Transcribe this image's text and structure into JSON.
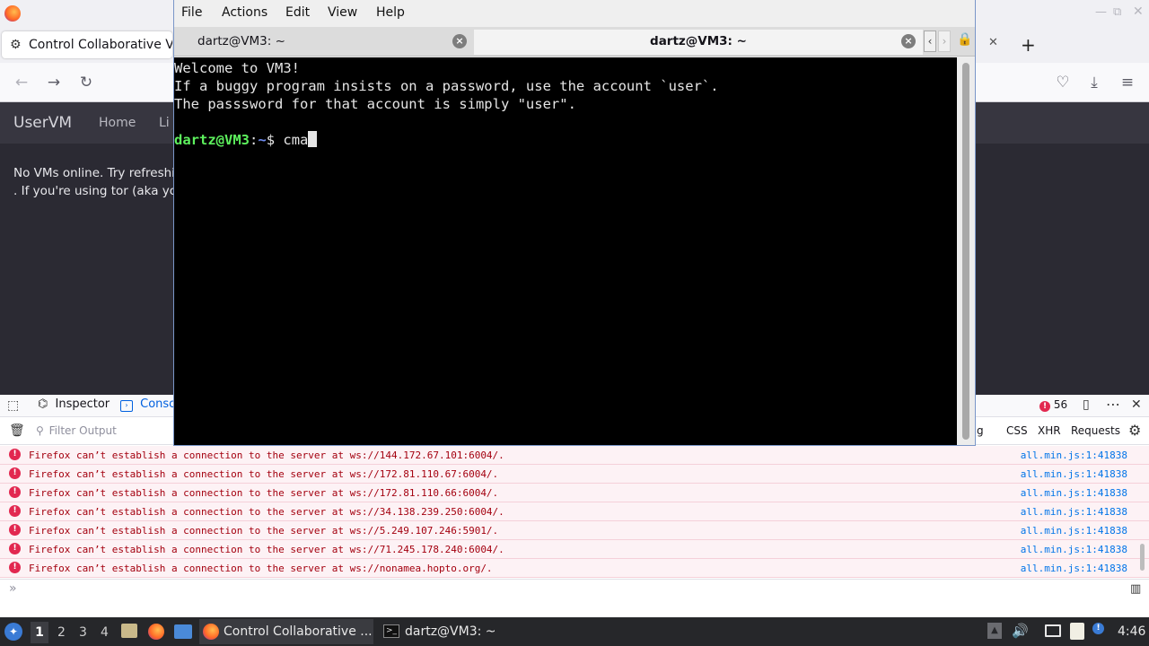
{
  "firefox": {
    "tab_title": "Control Collaborative Vi",
    "page": {
      "brand": "UserVM",
      "nav": [
        "Home",
        "Li"
      ],
      "message_line1": "No VMs online. Try refreshin",
      "message_line2": ". If you're using tor (aka you c"
    }
  },
  "devtools": {
    "tabs": {
      "inspector": "Inspector",
      "console": "Conso"
    },
    "error_count": "56",
    "filter_placeholder": "Filter Output",
    "filters": {
      "partial": "g",
      "css": "CSS",
      "xhr": "XHR",
      "requests": "Requests"
    },
    "logs": [
      {
        "message": "Firefox can’t establish a connection to the server at ws://144.172.67.101:6004/.",
        "source": "all.min.js:1:41838"
      },
      {
        "message": "Firefox can’t establish a connection to the server at ws://172.81.110.67:6004/.",
        "source": "all.min.js:1:41838"
      },
      {
        "message": "Firefox can’t establish a connection to the server at ws://172.81.110.66:6004/.",
        "source": "all.min.js:1:41838"
      },
      {
        "message": "Firefox can’t establish a connection to the server at ws://34.138.239.250:6004/.",
        "source": "all.min.js:1:41838"
      },
      {
        "message": "Firefox can’t establish a connection to the server at ws://5.249.107.246:5901/.",
        "source": "all.min.js:1:41838"
      },
      {
        "message": "Firefox can’t establish a connection to the server at ws://71.245.178.240:6004/.",
        "source": "all.min.js:1:41838"
      },
      {
        "message": "Firefox can’t establish a connection to the server at ws://nonamea.hopto.org/.",
        "source": "all.min.js:1:41838"
      }
    ]
  },
  "terminal": {
    "menu": [
      "File",
      "Actions",
      "Edit",
      "View",
      "Help"
    ],
    "tabs": [
      "dartz@VM3: ~",
      "dartz@VM3: ~"
    ],
    "lines": [
      "Welcome to VM3!",
      "If a buggy program insists on a password, use the account `user`.",
      "The passsword for that account is simply \"user\"."
    ],
    "prompt_user": "dartz@VM3",
    "prompt_sep": ":",
    "prompt_path": "~",
    "prompt_sym": "$ ",
    "typed": "cma"
  },
  "taskbar": {
    "workspaces": [
      "1",
      "2",
      "3",
      "4"
    ],
    "tasks": [
      "Control Collaborative ...",
      "dartz@VM3: ~"
    ],
    "clock": "4:46"
  }
}
